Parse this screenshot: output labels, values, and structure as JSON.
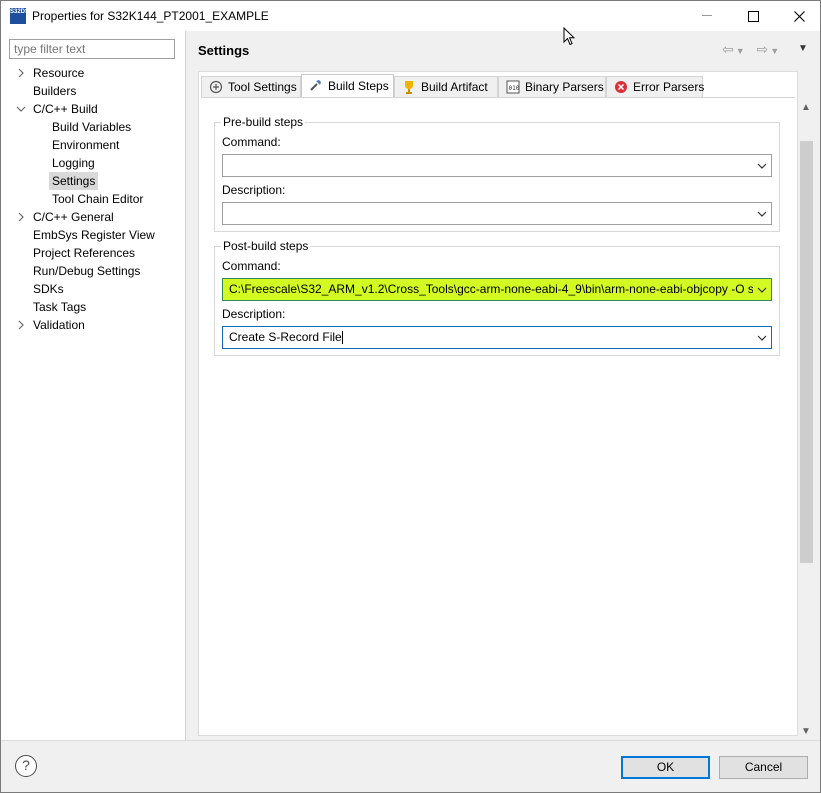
{
  "window": {
    "title": "Properties for S32K144_PT2001_EXAMPLE",
    "app_icon_text": "S32DS"
  },
  "filter": {
    "placeholder": "type filter text"
  },
  "tree": [
    {
      "label": "Resource",
      "expandable": true,
      "expanded": false,
      "level": 0
    },
    {
      "label": "Builders",
      "expandable": false,
      "level": 0
    },
    {
      "label": "C/C++ Build",
      "expandable": true,
      "expanded": true,
      "level": 0
    },
    {
      "label": "Build Variables",
      "level": 1
    },
    {
      "label": "Environment",
      "level": 1
    },
    {
      "label": "Logging",
      "level": 1
    },
    {
      "label": "Settings",
      "level": 1,
      "selected": true
    },
    {
      "label": "Tool Chain Editor",
      "level": 1
    },
    {
      "label": "C/C++ General",
      "expandable": true,
      "expanded": false,
      "level": 0
    },
    {
      "label": "EmbSys Register View",
      "level": 0
    },
    {
      "label": "Project References",
      "level": 0
    },
    {
      "label": "Run/Debug Settings",
      "level": 0
    },
    {
      "label": "SDKs",
      "level": 0
    },
    {
      "label": "Task Tags",
      "level": 0
    },
    {
      "label": "Validation",
      "expandable": true,
      "expanded": false,
      "level": 0
    }
  ],
  "settings": {
    "title": "Settings",
    "tabs": [
      {
        "label": "Tool Settings",
        "icon": "tool-settings-icon"
      },
      {
        "label": "Build Steps",
        "icon": "build-steps-icon",
        "active": true
      },
      {
        "label": "Build Artifact",
        "icon": "trophy-icon"
      },
      {
        "label": "Binary Parsers",
        "icon": "binary-icon"
      },
      {
        "label": "Error Parsers",
        "icon": "error-icon"
      }
    ],
    "prebuild": {
      "title": "Pre-build steps",
      "command_label": "Command:",
      "command_value": "",
      "description_label": "Description:",
      "description_value": ""
    },
    "postbuild": {
      "title": "Post-build steps",
      "command_label": "Command:",
      "command_value": "C:\\Freescale\\S32_ARM_v1.2\\Cross_Tools\\gcc-arm-none-eabi-4_9\\bin\\arm-none-eabi-objcopy -O srec",
      "description_label": "Description:",
      "description_value": "Create S-Record File"
    }
  },
  "buttons": {
    "ok": "OK",
    "cancel": "Cancel",
    "help": "?"
  },
  "colors": {
    "highlight": "#d3fa23",
    "ok_border": "#0078d7"
  }
}
